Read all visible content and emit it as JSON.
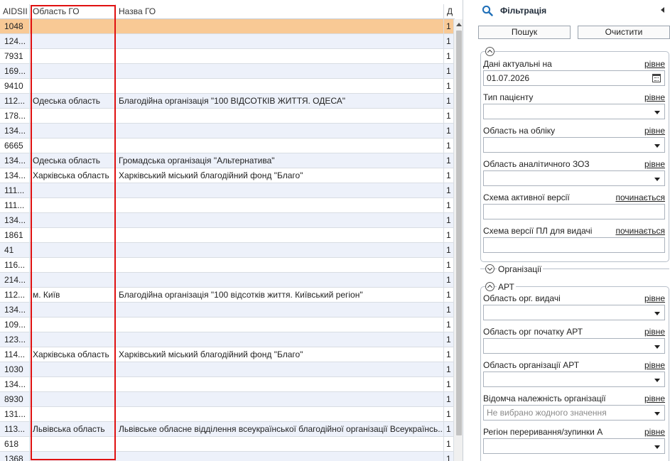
{
  "grid": {
    "columns": [
      "AIDSII",
      "Область ГО",
      "Назва ГО",
      "Д"
    ],
    "rows": [
      {
        "aid": "1048",
        "obl": "",
        "naz": "",
        "d": "1"
      },
      {
        "aid": "124...",
        "obl": "",
        "naz": "",
        "d": "1"
      },
      {
        "aid": "7931",
        "obl": "",
        "naz": "",
        "d": "1"
      },
      {
        "aid": "169...",
        "obl": "",
        "naz": "",
        "d": "1"
      },
      {
        "aid": "9410",
        "obl": "",
        "naz": "",
        "d": "1"
      },
      {
        "aid": "112...",
        "obl": "Одеська область",
        "naz": "Благодійна організація \"100 ВІДСОТКІВ ЖИТТЯ. ОДЕСА\"",
        "d": "1"
      },
      {
        "aid": "178...",
        "obl": "",
        "naz": "",
        "d": "1"
      },
      {
        "aid": "134...",
        "obl": "",
        "naz": "",
        "d": "1"
      },
      {
        "aid": "6665",
        "obl": "",
        "naz": "",
        "d": "1"
      },
      {
        "aid": "134...",
        "obl": "Одеська область",
        "naz": "Громадська організація \"Альтернатива\"",
        "d": "1"
      },
      {
        "aid": "134...",
        "obl": "Харківська область",
        "naz": "Харківський міський благодійний фонд \"Благо\"",
        "d": "1"
      },
      {
        "aid": "111...",
        "obl": "",
        "naz": "",
        "d": "1"
      },
      {
        "aid": "111...",
        "obl": "",
        "naz": "",
        "d": "1"
      },
      {
        "aid": "134...",
        "obl": "",
        "naz": "",
        "d": "1"
      },
      {
        "aid": "1861",
        "obl": "",
        "naz": "",
        "d": "1"
      },
      {
        "aid": "41",
        "obl": "",
        "naz": "",
        "d": "1"
      },
      {
        "aid": "116...",
        "obl": "",
        "naz": "",
        "d": "1"
      },
      {
        "aid": "214...",
        "obl": "",
        "naz": "",
        "d": "1"
      },
      {
        "aid": "112...",
        "obl": "м. Київ",
        "naz": "Благодійна організація \"100 відсотків життя. Київський регіон\"",
        "d": "1"
      },
      {
        "aid": "134...",
        "obl": "",
        "naz": "",
        "d": "1"
      },
      {
        "aid": "109...",
        "obl": "",
        "naz": "",
        "d": "1"
      },
      {
        "aid": "123...",
        "obl": "",
        "naz": "",
        "d": "1"
      },
      {
        "aid": "114...",
        "obl": "Харківська область",
        "naz": "Харківський міський благодійний фонд \"Благо\"",
        "d": "1"
      },
      {
        "aid": "1030",
        "obl": "",
        "naz": "",
        "d": "1"
      },
      {
        "aid": "134...",
        "obl": "",
        "naz": "",
        "d": "1"
      },
      {
        "aid": "8930",
        "obl": "",
        "naz": "",
        "d": "1"
      },
      {
        "aid": "131...",
        "obl": "",
        "naz": "",
        "d": "1"
      },
      {
        "aid": "113...",
        "obl": "Львівська область",
        "naz": "Львівське обласне відділення всеукраїнської благодійної організації Всеукраїнсь...",
        "d": "1"
      },
      {
        "aid": "618",
        "obl": "",
        "naz": "",
        "d": "1"
      },
      {
        "aid": "1368",
        "obl": "",
        "naz": "",
        "d": "1"
      }
    ],
    "selected_index": 0
  },
  "filter": {
    "title": "Фільтрація",
    "search_label": "Пошук",
    "clear_label": "Очистити",
    "group_org_label": "Організації",
    "group_art_label": "АРТ",
    "fields_main": [
      {
        "label": "Дані актуальні на",
        "mode": "рівне",
        "value": "01.07.2026",
        "kind": "date"
      },
      {
        "label": "Тип пацієнту",
        "mode": "рівне",
        "value": "",
        "kind": "select"
      },
      {
        "label": "Область на обліку",
        "mode": "рівне",
        "value": "",
        "kind": "select"
      },
      {
        "label": "Область аналітичного ЗОЗ",
        "mode": "рівне",
        "value": "",
        "kind": "select"
      },
      {
        "label": "Схема активної версії",
        "mode": "починається",
        "value": "",
        "kind": "text"
      },
      {
        "label": "Схема версії ПЛ для видачі",
        "mode": "починається",
        "value": "",
        "kind": "text"
      }
    ],
    "fields_art": [
      {
        "label": "Область орг. видачі",
        "mode": "рівне",
        "value": "",
        "kind": "select"
      },
      {
        "label": "Область орг початку АРТ",
        "mode": "рівне",
        "value": "",
        "kind": "select"
      },
      {
        "label": "Область організації АРТ",
        "mode": "рівне",
        "value": "",
        "kind": "select"
      },
      {
        "label": "Відомча належність організації",
        "mode": "рівне",
        "value": "",
        "placeholder": "Не вибрано жодного значення",
        "kind": "select"
      },
      {
        "label": "Регіон переривання/зупинки А",
        "mode": "рівне",
        "value": "",
        "kind": "select"
      }
    ]
  },
  "colors": {
    "selected_row": "#f8c995",
    "alt_row": "#edf1fa",
    "highlight_border": "#e01010",
    "accent": "#1f6fb8"
  },
  "icons": [
    "search-icon",
    "collapse-arrow-icon",
    "calendar-icon",
    "dropdown-arrow-icon",
    "group-toggle-icon"
  ]
}
